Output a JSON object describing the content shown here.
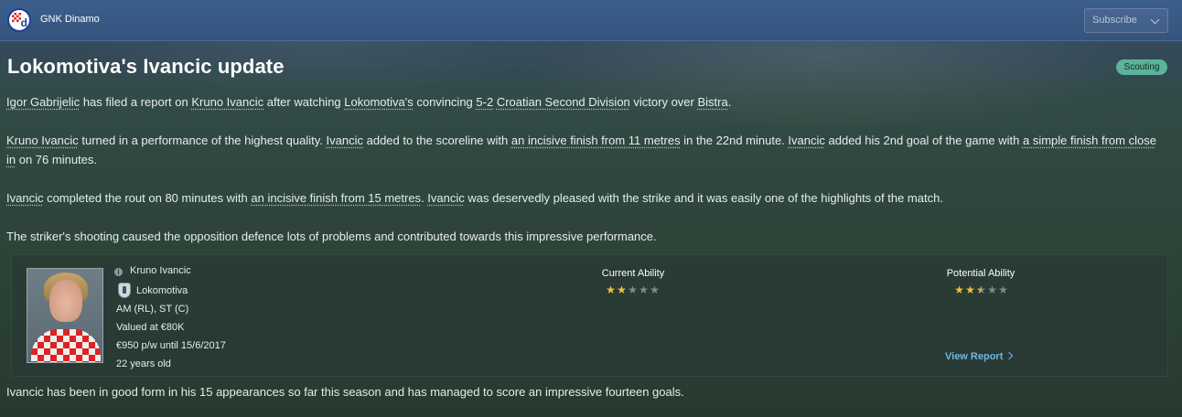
{
  "topbar": {
    "club_name": "GNK Dinamo",
    "subscribe_label": "Subscribe"
  },
  "article": {
    "title": "Lokomotiva's Ivancic update",
    "tag": "Scouting",
    "p1": {
      "scout": "Igor Gabrijelic",
      "t1": " has filed a report on ",
      "player": "Kruno Ivancic",
      "t2": " after watching ",
      "team": "Lokomotiva's",
      "t3": " convincing ",
      "score": "5-2",
      "t4": " ",
      "competition": "Croatian Second Division",
      "t5": " victory over ",
      "opponent": "Bistra",
      "t6": "."
    },
    "p2": {
      "player": "Kruno Ivancic",
      "t1": " turned in a performance of the highest quality. ",
      "name2": "Ivancic",
      "t2": " added to the scoreline with ",
      "goal1": "an incisive finish from 11 metres",
      "t3": " in the 22nd minute. ",
      "name3": "Ivancic",
      "t4": " added his 2nd goal of the game with ",
      "goal2": "a simple finish from close in",
      "t5": " on 76 minutes."
    },
    "p3": {
      "name1": "Ivancic",
      "t1": " completed the rout on 80 minutes with ",
      "goal3": "an incisive finish from 15 metres",
      "t2": ". ",
      "name2": "Ivancic",
      "t3": " was deservedly pleased with the strike and it was easily one of the highlights of the match."
    },
    "p4": "The striker's shooting caused the opposition defence lots of problems and contributed towards this impressive performance.",
    "p5": "Ivancic has been in good form in his 15 appearances so far this season and has managed to score an impressive fourteen goals."
  },
  "player_card": {
    "name": "Kruno Ivancic",
    "club": "Lokomotiva",
    "positions": "AM (RL), ST (C)",
    "value": "Valued at €80K",
    "contract": "€950 p/w until 15/6/2017",
    "age": "22 years old",
    "current_ability_label": "Current Ability",
    "current_ability_stars": 2,
    "potential_ability_label": "Potential Ability",
    "potential_ability_stars": 2.5,
    "star_count": 5,
    "view_report_label": "View Report",
    "info_icon": "info-icon",
    "club_icon": "club-crest-icon"
  },
  "colors": {
    "topbar": "#35547d",
    "tag": "#5bb39a",
    "star": "#f1c232",
    "link": "#6fb6e6"
  }
}
